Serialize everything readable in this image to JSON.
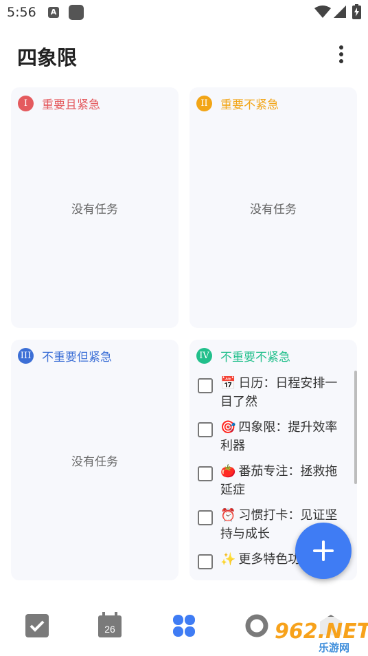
{
  "status_bar": {
    "time": "5:56",
    "notification_glyph": "A"
  },
  "app_bar": {
    "title": "四象限",
    "menu_icon": "more-vert-icon"
  },
  "quadrants": [
    {
      "numeral": "I",
      "label": "重要且紧急",
      "color": "#e45a5e",
      "empty_text": "没有任务"
    },
    {
      "numeral": "II",
      "label": "重要不紧急",
      "color": "#f2a516",
      "empty_text": "没有任务"
    },
    {
      "numeral": "III",
      "label": "不重要但紧急",
      "color": "#3c6fd6",
      "empty_text": "没有任务"
    },
    {
      "numeral": "IV",
      "label": "不重要不紧急",
      "color": "#21bf8b",
      "tasks": [
        {
          "emoji": "📅",
          "text": "日历：日程安排一目了然"
        },
        {
          "emoji": "🎯",
          "text": "四象限：提升效率利器"
        },
        {
          "emoji": "🍅",
          "text": "番茄专注：拯救拖延症"
        },
        {
          "emoji": "⏰",
          "text": "习惯打卡：见证坚持与成长"
        },
        {
          "emoji": "✨",
          "text": "更多特色功"
        }
      ]
    }
  ],
  "fab": {
    "icon": "plus-icon"
  },
  "bottom_nav": {
    "items": [
      {
        "name": "tasks",
        "icon": "checkbox-icon"
      },
      {
        "name": "calendar",
        "icon": "calendar-icon",
        "label": "26"
      },
      {
        "name": "quadrant",
        "icon": "four-leaf-icon",
        "active": true
      },
      {
        "name": "pomodoro",
        "icon": "ring-icon"
      },
      {
        "name": "habit",
        "icon": "box-icon"
      }
    ],
    "active_color": "#3f7cf4",
    "inactive_color": "#7a7a7a"
  },
  "watermark": {
    "main": "962.NET",
    "sub": "乐游网"
  }
}
